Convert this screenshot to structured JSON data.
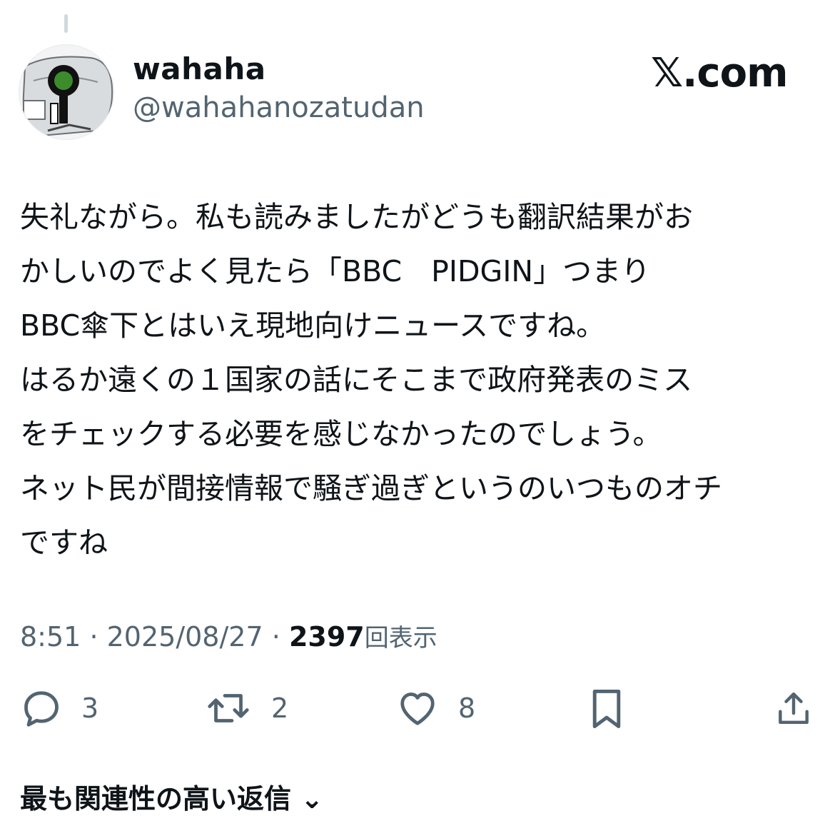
{
  "author": {
    "display_name": "wahaha",
    "handle": "@wahahanozatudan",
    "avatar_icon": "robot-avatar-icon"
  },
  "brand": {
    "x_glyph": "𝕏",
    "domain": ".com"
  },
  "tweet": {
    "text": "失礼ながら。私も読みましたがどうも翻訳結果がお\nかしいのでよく見たら「BBC　PIDGIN」つまり\nBBC傘下とはいえ現地向けニュースですね。\nはるか遠くの１国家の話にそこまで政府発表のミス\nをチェックする必要を感じなかったのでしょう。\nネット民が間接情報で騒ぎ過ぎというのいつものオチ\nですね",
    "time": "8:51",
    "separator": "·",
    "date": "2025/08/27",
    "views": "2397",
    "views_label": "回表示"
  },
  "actions": {
    "reply_count": "3",
    "retweet_count": "2",
    "like_count": "8"
  },
  "related_replies": "最も関連性の高い返信",
  "colors": {
    "text": "#0f1419",
    "muted": "#536471",
    "avatar_accent": "#3c8c2c"
  }
}
